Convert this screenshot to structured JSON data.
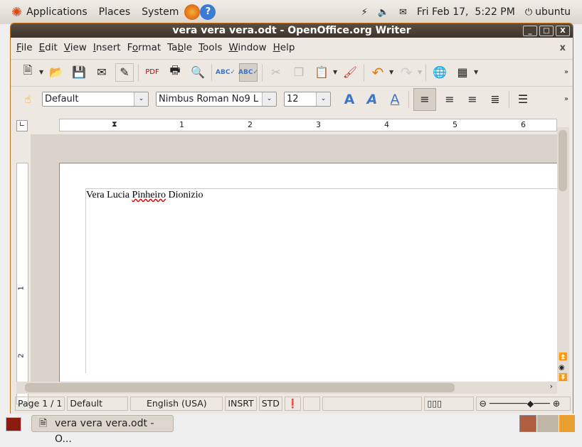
{
  "panel": {
    "menus": [
      "Applications",
      "Places",
      "System"
    ],
    "clock": "Fri Feb 17,  5:22 PM",
    "user": "ubuntu"
  },
  "window": {
    "title": "vera vera vera.odt - OpenOffice.org Writer",
    "minimize": "_",
    "maximize": "□",
    "close": "X"
  },
  "menubar": {
    "items": [
      {
        "u": "F",
        "rest": "ile"
      },
      {
        "u": "E",
        "rest": "dit"
      },
      {
        "u": "V",
        "rest": "iew"
      },
      {
        "u": "I",
        "rest": "nsert"
      },
      {
        "pre": "F",
        "u": "o",
        "rest": "rmat"
      },
      {
        "pre": "Ta",
        "u": "b",
        "rest": "le"
      },
      {
        "u": "T",
        "rest": "ools"
      },
      {
        "u": "W",
        "rest": "indow"
      },
      {
        "u": "H",
        "rest": "elp"
      }
    ],
    "close_doc": "x"
  },
  "formatting": {
    "style": "Default",
    "font": "Nimbus Roman No9 L",
    "size": "12"
  },
  "ruler": {
    "marks": [
      "1",
      "2",
      "3",
      "4",
      "5",
      "6"
    ]
  },
  "vruler": {
    "marks": [
      "1",
      "2"
    ]
  },
  "document": {
    "text_a": "Vera Lucia ",
    "text_misspelled": "Pinheiro",
    "text_b": " Dionizio"
  },
  "status": {
    "page": "Page 1 / 1",
    "style": "Default",
    "language": "English (USA)",
    "insert_mode": "INSRT",
    "selection_mode": "STD"
  },
  "taskbar": {
    "task": "vera vera vera.odt - O..."
  },
  "colors": {
    "title_bar": "#4a3f35",
    "window_border": "#c2701e",
    "accent_blue": "#3b77c8"
  }
}
